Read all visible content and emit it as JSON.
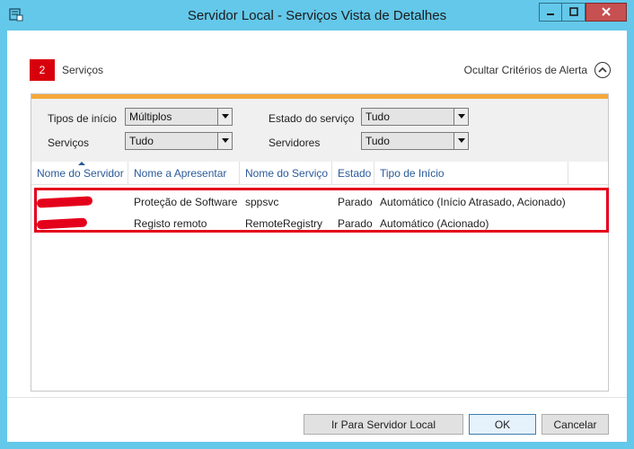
{
  "window": {
    "title": "Servidor Local - Serviços Vista de Detalhes",
    "accent_color": "#64c8ea"
  },
  "header": {
    "count": "2",
    "title": "Serviços",
    "alert_toggle_label": "Ocultar Critérios de Alerta"
  },
  "filters": {
    "start_type_label": "Tipos de início",
    "start_type_value": "Múltiplos",
    "services_label": "Serviços",
    "services_value": "Tudo",
    "state_label": "Estado do serviço",
    "state_value": "Tudo",
    "servers_label": "Servidores",
    "servers_value": "Tudo"
  },
  "table": {
    "columns": [
      "Nome do Servidor",
      "Nome a Apresentar",
      "Nome do Serviço",
      "Estado",
      "Tipo de Início"
    ],
    "rows": [
      {
        "server": "",
        "display_name": "Proteção de Software",
        "service_name": "sppsvc",
        "state": "Parado",
        "start_type": "Automático (Início Atrasado, Acionado)"
      },
      {
        "server": "",
        "display_name": "Registo remoto",
        "service_name": "RemoteRegistry",
        "state": "Parado",
        "start_type": "Automático (Acionado)"
      }
    ]
  },
  "footer": {
    "goto_label": "Ir Para Servidor Local",
    "ok_label": "OK",
    "cancel_label": "Cancelar"
  },
  "colors": {
    "badge": "#d8000c",
    "panel_accent": "#f4a83a",
    "highlight": "#e4001b"
  }
}
